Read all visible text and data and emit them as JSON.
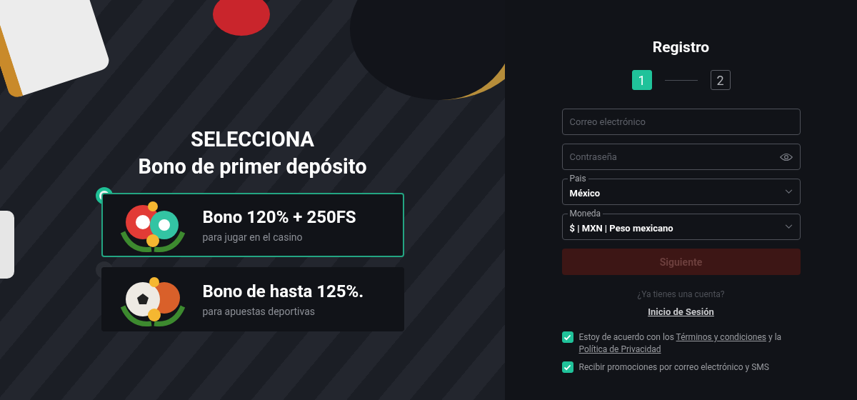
{
  "promo": {
    "heading": "SELECCIONA",
    "subheading": "Bono de primer depósito",
    "bonuses": [
      {
        "kind": "casino",
        "title": "Bono 120% + 250FS",
        "subtitle": "para jugar en el casino",
        "selected": true
      },
      {
        "kind": "sports",
        "title": "Bono de hasta 125%.",
        "subtitle": "para apuestas deportivas",
        "selected": false
      }
    ]
  },
  "form": {
    "title": "Registro",
    "steps": [
      {
        "label": "1",
        "selected": true
      },
      {
        "label": "2",
        "selected": false
      }
    ],
    "email": {
      "placeholder": "Correo electrónico"
    },
    "password": {
      "placeholder": "Contraseña"
    },
    "country": {
      "label": "Pais",
      "value": "México"
    },
    "currency": {
      "label": "Moneda",
      "value": "$ | MXN | Peso mexicano"
    },
    "submit": {
      "label": "Siguiente",
      "disabled": true
    },
    "login_prompt": "¿Ya tienes una cuenta?",
    "login_link": "Inicio de Sesión",
    "consents": [
      {
        "checked": true,
        "parts": [
          {
            "kind": "text",
            "text": "Estoy de acuerdo con los "
          },
          {
            "kind": "link",
            "text": "Términos y condiciones"
          },
          {
            "kind": "text",
            "text": " y la "
          },
          {
            "kind": "link",
            "text": "Política de Privacidad"
          }
        ]
      },
      {
        "checked": true,
        "parts": [
          {
            "kind": "text",
            "text": "Recibir promociones por correo electrónico y SMS"
          }
        ]
      }
    ]
  }
}
